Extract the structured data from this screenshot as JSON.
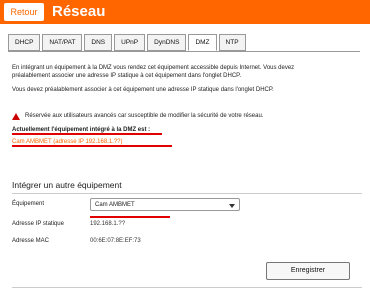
{
  "header": {
    "back_label": "Retour",
    "title": "Réseau",
    "bg_color": "#ff6600"
  },
  "tabs": [
    {
      "label": "DHCP"
    },
    {
      "label": "NAT/PAT"
    },
    {
      "label": "DNS"
    },
    {
      "label": "UPnP"
    },
    {
      "label": "DynDNS"
    },
    {
      "label": "DMZ",
      "active": true
    },
    {
      "label": "NTP"
    }
  ],
  "intro": {
    "line1": "En intégrant un équipement à la DMZ vous rendez cet équipement accessible depuis Internet. Vous devez",
    "line2": "préalablement associer une adresse IP statique à cet équipement dans l'onglet DHCP.",
    "line3": "Vous devez préalablement associer à cet équipement une adresse IP statique dans l'onglet DHCP.",
    "warning": "Réservée aux utilisateurs avancés car susceptible de modifier la sécurité de votre réseau."
  },
  "current": {
    "heading": "Actuellement l'équipement intégré à la DMZ est :",
    "value": "Cam AMBMET (adresse IP 192.168.1.??)"
  },
  "form": {
    "section_title": "Intégrer un autre équipement",
    "equipment_label": "Équipement",
    "equipment_value": "Cam AMBMET",
    "ip_label": "Adresse IP statique",
    "ip_value": "192.168.1.??",
    "mac_label": "Adresse MAC",
    "mac_value": "00:6E:07:8E:EF:73",
    "submit_label": "Enregistrer"
  }
}
